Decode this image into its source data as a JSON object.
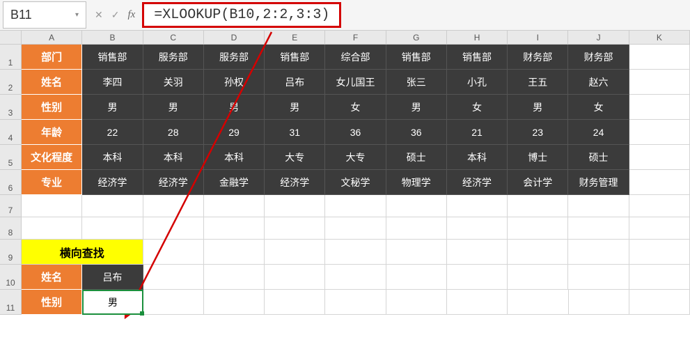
{
  "name_box": "B11",
  "formula": "=XLOOKUP(B10,2:2,3:3)",
  "columns": [
    "A",
    "B",
    "C",
    "D",
    "E",
    "F",
    "G",
    "H",
    "I",
    "J",
    "K"
  ],
  "row_numbers": [
    1,
    2,
    3,
    4,
    5,
    6,
    7,
    8,
    9,
    10,
    11
  ],
  "table": {
    "row_labels": [
      "部门",
      "姓名",
      "性别",
      "年龄",
      "文化程度",
      "专业"
    ],
    "rows": [
      [
        "销售部",
        "服务部",
        "服务部",
        "销售部",
        "综合部",
        "销售部",
        "销售部",
        "财务部",
        "财务部"
      ],
      [
        "李四",
        "关羽",
        "孙权",
        "吕布",
        "女儿国王",
        "张三",
        "小孔",
        "王五",
        "赵六"
      ],
      [
        "男",
        "男",
        "男",
        "男",
        "女",
        "男",
        "女",
        "男",
        "女"
      ],
      [
        "22",
        "28",
        "29",
        "31",
        "36",
        "36",
        "21",
        "23",
        "24"
      ],
      [
        "本科",
        "本科",
        "本科",
        "大专",
        "大专",
        "硕士",
        "本科",
        "博士",
        "硕士"
      ],
      [
        "经济学",
        "经济学",
        "金融学",
        "经济学",
        "文秘学",
        "物理学",
        "经济学",
        "会计学",
        "财务管理"
      ]
    ]
  },
  "lookup": {
    "title": "横向查找",
    "name_label": "姓名",
    "name_value": "吕布",
    "gender_label": "性别",
    "gender_value": "男"
  },
  "fbar_icons": {
    "cancel": "✕",
    "confirm": "✓",
    "fx": "fx"
  }
}
